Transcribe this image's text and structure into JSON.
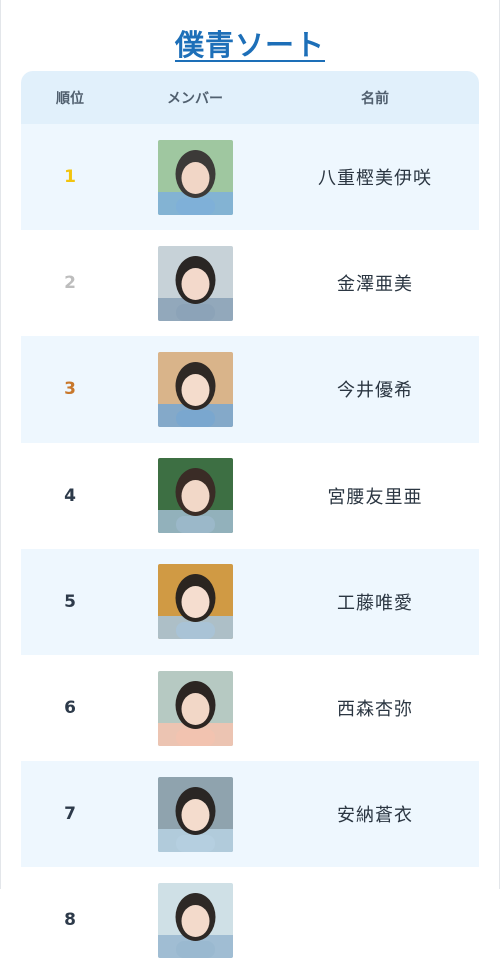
{
  "title": "僕青ソート",
  "table": {
    "headers": {
      "rank": "順位",
      "member": "メンバー",
      "name": "名前"
    },
    "rows": [
      {
        "rank": "1",
        "name": "八重樫美伊咲",
        "rank_color": "#f2c40f"
      },
      {
        "rank": "2",
        "name": "金澤亜美",
        "rank_color": "#bdbdbd"
      },
      {
        "rank": "3",
        "name": "今井優希",
        "rank_color": "#c8782c"
      },
      {
        "rank": "4",
        "name": "宮腰友里亜",
        "rank_color": "#2d3a4a"
      },
      {
        "rank": "5",
        "name": "工藤唯愛",
        "rank_color": "#2d3a4a"
      },
      {
        "rank": "6",
        "name": "西森杏弥",
        "rank_color": "#2d3a4a"
      },
      {
        "rank": "7",
        "name": "安納蒼衣",
        "rank_color": "#2d3a4a"
      },
      {
        "rank": "8",
        "name": "",
        "rank_color": "#2d3a4a"
      }
    ]
  },
  "colors": {
    "accent": "#1d6fb8",
    "header_bg": "#e1f0fb",
    "row_alt_bg": "#eef7fe"
  }
}
